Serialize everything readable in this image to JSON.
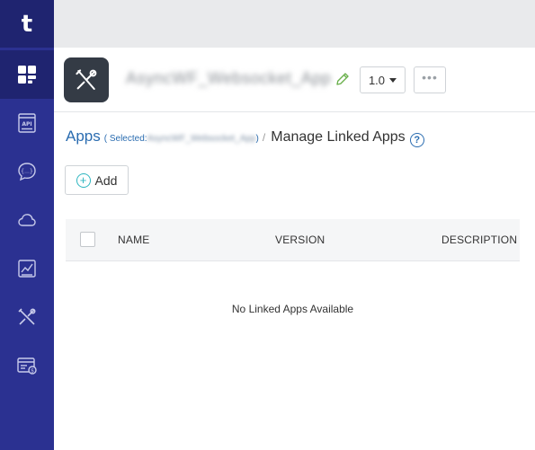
{
  "sidebar": {
    "logo": "t",
    "items": [
      {
        "icon": "dashboard-icon"
      },
      {
        "icon": "api-icon"
      },
      {
        "icon": "message-icon"
      },
      {
        "icon": "cloud-icon"
      },
      {
        "icon": "analytics-icon"
      },
      {
        "icon": "tools-icon"
      },
      {
        "icon": "billing-icon"
      }
    ]
  },
  "header": {
    "app_name": "AsyncWF_Websocket_App",
    "version": "1.0",
    "more": "•••"
  },
  "breadcrumb": {
    "apps": "Apps",
    "selected_prefix": "( Selected:",
    "selected_value": "AsyncWF_Websocket_App",
    "selected_suffix": ")",
    "separator": "/",
    "current": "Manage Linked Apps",
    "help": "?"
  },
  "actions": {
    "add_label": "Add"
  },
  "table": {
    "columns": [
      "NAME",
      "VERSION",
      "DESCRIPTION"
    ],
    "empty_message": "No Linked Apps Available"
  },
  "colors": {
    "sidebar": "#2b3191",
    "sidebar_active": "#1f2470",
    "link": "#2a6cb0",
    "add_accent": "#2eb6c0"
  }
}
